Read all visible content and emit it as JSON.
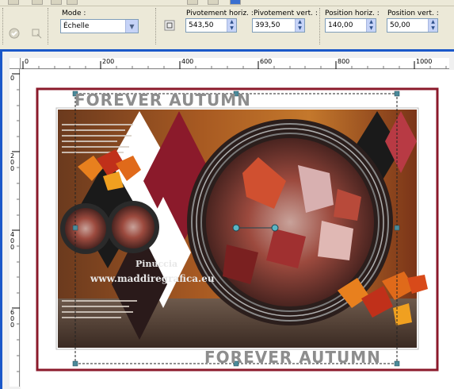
{
  "toolbar": {
    "mode_label": "Mode :",
    "mode_value": "Échelle",
    "pivot_h_label": "Pivotement horiz. :",
    "pivot_h_value": "543,50",
    "pivot_v_label": "Pivotement vert. :",
    "pivot_v_value": "393,50",
    "pos_h_label": "Position horiz. :",
    "pos_h_value": "140,00",
    "pos_v_label": "Position vert. :",
    "pos_v_value": "50,00"
  },
  "ruler": {
    "h_ticks": [
      "0",
      "200",
      "400",
      "600",
      "800",
      "1000"
    ],
    "v_ticks": [
      "0",
      "200",
      "400",
      "600"
    ]
  },
  "canvas": {
    "watermark_top": "FOREVER AUTUMN",
    "watermark_bottom": "FOREVER AUTUMN",
    "credit_name": "Pinuccia",
    "credit_url": "www.maddiregrafica.eu"
  },
  "colors": {
    "frame_red": "#8b1a2b",
    "workspace_blue": "#1b58c9"
  }
}
